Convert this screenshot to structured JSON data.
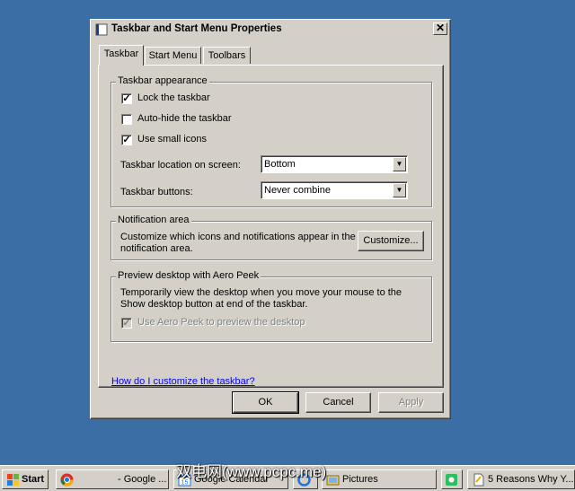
{
  "window": {
    "title": "Taskbar and Start Menu Properties",
    "close_glyph": "✕"
  },
  "tabs": [
    {
      "label": "Taskbar",
      "active": true
    },
    {
      "label": "Start Menu",
      "active": false
    },
    {
      "label": "Toolbars",
      "active": false
    }
  ],
  "appearance": {
    "legend": "Taskbar appearance",
    "lock_label": "Lock the taskbar",
    "lock_checked": true,
    "autohide_label": "Auto-hide the taskbar",
    "autohide_checked": false,
    "small_icons_label": "Use small icons",
    "small_icons_checked": true,
    "location_label": "Taskbar location on screen:",
    "location_value": "Bottom",
    "buttons_label": "Taskbar buttons:",
    "buttons_value": "Never combine"
  },
  "notification": {
    "legend": "Notification area",
    "description": "Customize which icons and notifications appear in the notification area.",
    "customize_label": "Customize..."
  },
  "peek": {
    "legend": "Preview desktop with Aero Peek",
    "description": "Temporarily view the desktop when you move your mouse to the Show desktop button at end of the taskbar.",
    "checkbox_label": "Use Aero Peek to preview the desktop",
    "checked": true,
    "disabled": true
  },
  "help_link": "How do I customize the taskbar?",
  "buttons": {
    "ok": "OK",
    "cancel": "Cancel",
    "apply": "Apply"
  },
  "taskbar": {
    "start_label": "Start",
    "tasks": [
      {
        "label": "- Google ...",
        "icon": "chrome-icon"
      },
      {
        "label": "Google Calendar",
        "icon": "calendar-icon"
      },
      {
        "label": "",
        "icon": "app-icon"
      },
      {
        "label": "Pictures",
        "icon": "folder-icon"
      },
      {
        "label": "",
        "icon": "evernote-icon"
      },
      {
        "label": "5 Reasons Why Y...",
        "icon": "document-icon"
      }
    ]
  },
  "watermark": "双电网(www.pcpc.me)",
  "colors": {
    "desktop": "#3a6ea5",
    "face": "#d4d0c8",
    "link": "#0000ff"
  }
}
